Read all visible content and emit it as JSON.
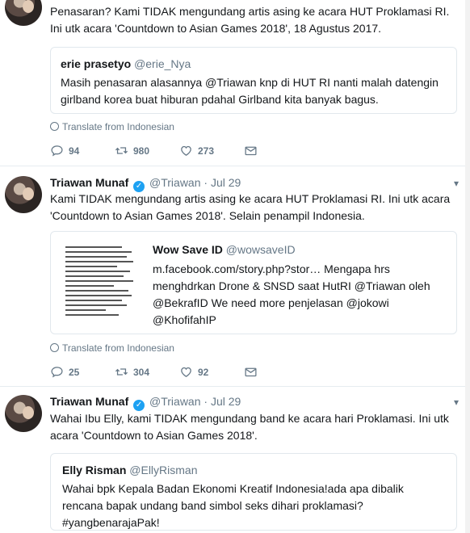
{
  "tweet1": {
    "text": "Penasaran? Kami TIDAK mengundang artis asing ke acara HUT Proklamasi RI. Ini utk acara 'Countdown to Asian Games 2018', 18 Agustus 2017.",
    "quote": {
      "name": "erie prasetyo",
      "handle": "@erie_Nya",
      "text": "Masih penasaran alasannya @Triawan knp di HUT RI nanti malah datengin girlband korea buat hiburan pdahal Girlband kita banyak bagus."
    },
    "translate": "Translate from Indonesian",
    "replies": "94",
    "retweets": "980",
    "likes": "273"
  },
  "tweet2": {
    "name": "Triawan Munaf",
    "handle": "@Triawan",
    "dot": "·",
    "date": "Jul 29",
    "text": "Kami TIDAK mengundang artis asing ke acara HUT Proklamasi RI. Ini utk acara 'Countdown to Asian Games 2018'. Selain penampil Indonesia.",
    "quote": {
      "name": "Wow Save ID",
      "handle": "@wowsaveID",
      "text": "m.facebook.com/story.php?stor… Mengapa hrs menghdrkan Drone & SNSD saat HutRI @Triawan oleh @BekrafID We need more penjelasan @jokowi @KhofifahIP"
    },
    "translate": "Translate from Indonesian",
    "replies": "25",
    "retweets": "304",
    "likes": "92"
  },
  "tweet3": {
    "name": "Triawan Munaf",
    "handle": "@Triawan",
    "dot": "·",
    "date": "Jul 29",
    "text": "Wahai Ibu Elly, kami TIDAK mengundang band ke acara hari Proklamasi. Ini utk acara 'Countdown to Asian Games 2018'.",
    "quote": {
      "name": "Elly Risman",
      "handle": "@EllyRisman",
      "text": "Wahai bpk Kepala Badan Ekonomi Kreatif Indonesia!ada apa dibalik rencana bapak undang band simbol seks dihari proklamasi? #yangbenarajaPak!"
    }
  },
  "icons": [
    "reply-icon",
    "retweet-icon",
    "like-icon",
    "dm-icon",
    "globe-icon",
    "verified-icon",
    "chevron-down-icon"
  ],
  "colors": {
    "text": "#14171a",
    "muted": "#657786",
    "verified": "#1da1f2",
    "border": "#e1e8ed"
  }
}
